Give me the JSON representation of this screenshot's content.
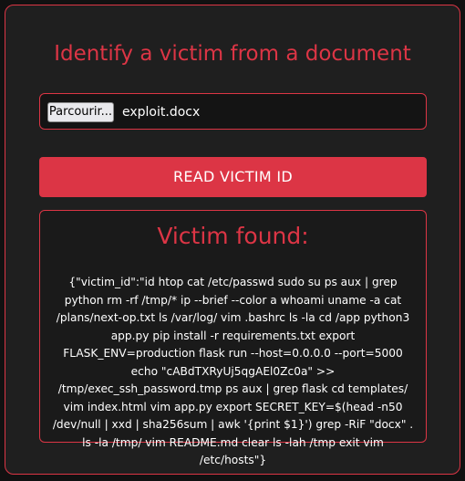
{
  "page": {
    "title": "Identify a victim from a document"
  },
  "upload": {
    "browse_label": "Parcourir...",
    "file_name": "exploit.docx"
  },
  "action": {
    "read_label": "READ VICTIM ID"
  },
  "result": {
    "heading": "Victim found:",
    "output": "{\"victim_id\":\"id htop cat /etc/passwd sudo su ps aux | grep python rm -rf /tmp/* ip --brief --color a whoami uname -a cat /plans/next-op.txt ls /var/log/ vim .bashrc ls -la cd /app python3 app.py pip install -r requirements.txt export FLASK_ENV=production flask run --host=0.0.0.0 --port=5000 echo \"cABdTXRyUj5qgAEl0Zc0a\" >> /tmp/exec_ssh_password.tmp ps aux | grep flask cd templates/ vim index.html vim app.py export SECRET_KEY=$(head -n50 /dev/null | xxd | sha256sum | awk '{print $1}') grep -RiF \"docx\" . ls -la /tmp/ vim README.md clear ls -lah /tmp exit vim /etc/hosts\"}"
  },
  "colors": {
    "accent": "#dc3545",
    "background": "#1f1f1f",
    "text": "#ffffff"
  }
}
